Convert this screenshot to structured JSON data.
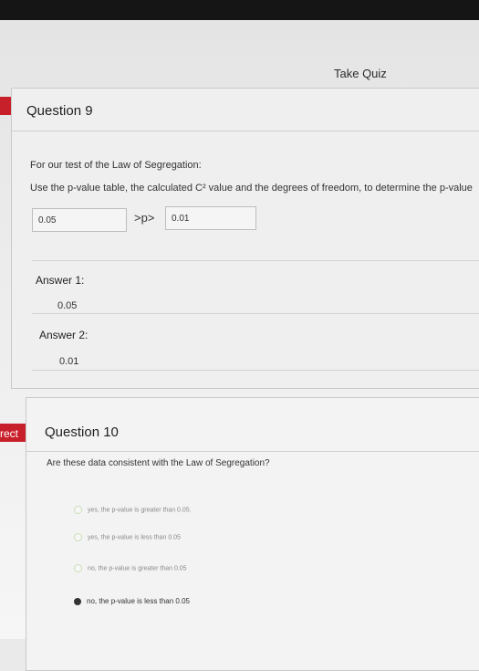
{
  "header": {
    "take_quiz_label": "Take Quiz"
  },
  "side_flag": {
    "text": "rect"
  },
  "question9": {
    "title": "Question 9",
    "prompt_line1": "For our test of the Law of Segregation:",
    "prompt_line2": "Use the p-value table, the calculated C² value and the degrees of freedom, to determine the p-value",
    "blank1_value": "0.05",
    "between_text": ">p>",
    "blank2_value": "0.01",
    "answer1_label": "Answer 1:",
    "answer1_value": "0.05",
    "answer2_label": "Answer 2:",
    "answer2_value": "0.01"
  },
  "question10": {
    "title": "Question 10",
    "prompt": "Are these data consistent with the Law of Segregation?",
    "options": [
      {
        "label": "yes, the p-value is greater than 0.05.",
        "selected": false
      },
      {
        "label": "yes, the p-value is less than 0.05",
        "selected": false
      },
      {
        "label": "no, the p-value is greater than 0.05",
        "selected": false
      },
      {
        "label": "no, the p-value is less than 0.05",
        "selected": true
      }
    ]
  },
  "colors": {
    "flag": "#c8202a",
    "radio_border": "#c8dfb5",
    "selected_radio": "#333333"
  }
}
